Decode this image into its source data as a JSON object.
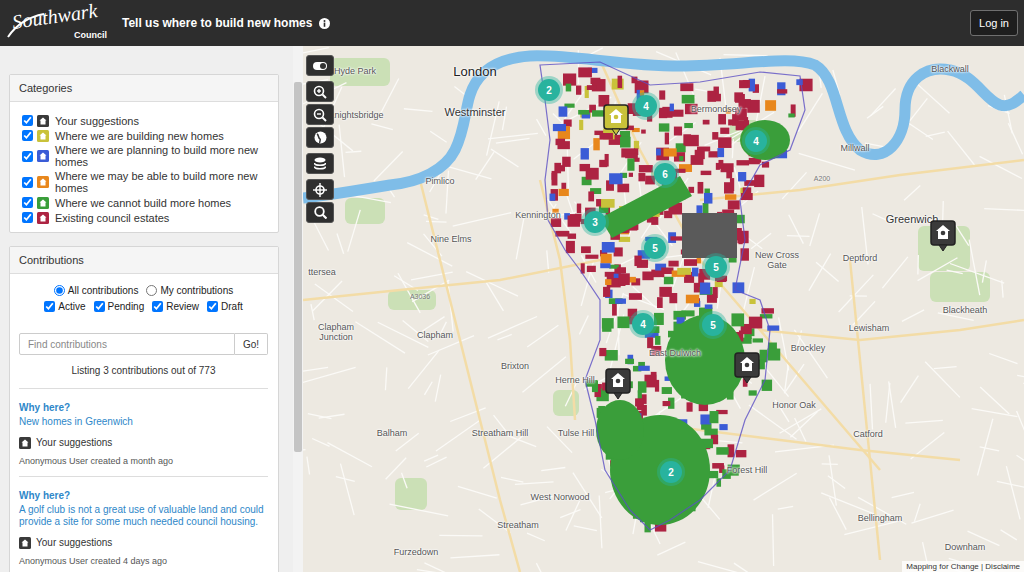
{
  "header": {
    "logo_title": "Southwark",
    "logo_subtitle": "Council",
    "title": "Tell us where to build new homes",
    "login_button": "Log in"
  },
  "categories": {
    "title": "Categories",
    "items": [
      {
        "label": "Your suggestions",
        "checked": true,
        "color": "#3a3a3a"
      },
      {
        "label": "Where we are building new homes",
        "checked": true,
        "color": "#c9c23a"
      },
      {
        "label": "Where we are planning to build more new homes",
        "checked": true,
        "color": "#3b5cd6"
      },
      {
        "label": "Where we may be able to build more new homes",
        "checked": true,
        "color": "#e8871c"
      },
      {
        "label": "Where we cannot build more homes",
        "checked": true,
        "color": "#3a9e3a"
      },
      {
        "label": "Existing council estates",
        "checked": true,
        "color": "#ad2342"
      }
    ]
  },
  "contributions": {
    "title": "Contributions",
    "scope": [
      {
        "label": "All contributions",
        "selected": true
      },
      {
        "label": "My contributions",
        "selected": false
      }
    ],
    "filters": [
      {
        "label": "Active",
        "checked": true
      },
      {
        "label": "Pending",
        "checked": true
      },
      {
        "label": "Review",
        "checked": true
      },
      {
        "label": "Draft",
        "checked": true
      }
    ],
    "search": {
      "placeholder": "Find contributions",
      "button": "Go!"
    },
    "summary": "Listing 3 contributions out of 773",
    "items": [
      {
        "heading": "Why here?",
        "title": "New homes in Greenwich",
        "category": "Your suggestions",
        "meta": "Anonymous User created a month ago"
      },
      {
        "heading": "Why here?",
        "title": "A golf club is not a great use of valuable land and could provide a site for some much needed council housing.",
        "category": "Your suggestions",
        "meta": "Anonymous User created 4 days ago"
      }
    ]
  },
  "map": {
    "place_labels": [
      {
        "text": "London",
        "kind": "city"
      },
      {
        "text": "Westminster",
        "kind": "town"
      },
      {
        "text": "Bermondsey",
        "kind": "district"
      },
      {
        "text": "Blackwall",
        "kind": "district"
      },
      {
        "text": "Knightsbridge",
        "kind": "district"
      },
      {
        "text": "Hyde Park",
        "kind": "district"
      },
      {
        "text": "Pimlico",
        "kind": "district"
      },
      {
        "text": "Kennington",
        "kind": "district"
      },
      {
        "text": "Nine Elms",
        "kind": "district"
      },
      {
        "text": "Millwall",
        "kind": "district"
      },
      {
        "text": "Greenwich",
        "kind": "town"
      },
      {
        "text": "Deptford",
        "kind": "district"
      },
      {
        "text": "New Cross Gate",
        "kind": "district"
      },
      {
        "text": "Blackheath",
        "kind": "district"
      },
      {
        "text": "Lewisham",
        "kind": "district"
      },
      {
        "text": "Brockley",
        "kind": "district"
      },
      {
        "text": "Clapham Junction",
        "kind": "district"
      },
      {
        "text": "Clapham",
        "kind": "district"
      },
      {
        "text": "Brixton",
        "kind": "district"
      },
      {
        "text": "Herne Hill",
        "kind": "district"
      },
      {
        "text": "East Dulwich",
        "kind": "district"
      },
      {
        "text": "Honor Oak",
        "kind": "district"
      },
      {
        "text": "Balham",
        "kind": "district"
      },
      {
        "text": "Streatham Hill",
        "kind": "district"
      },
      {
        "text": "Tulse Hill",
        "kind": "district"
      },
      {
        "text": "Catford",
        "kind": "district"
      },
      {
        "text": "Forest Hill",
        "kind": "district"
      },
      {
        "text": "West Norwood",
        "kind": "district"
      },
      {
        "text": "Streatham",
        "kind": "district"
      },
      {
        "text": "Bellingham",
        "kind": "district"
      },
      {
        "text": "Furzedown",
        "kind": "district"
      },
      {
        "text": "Downham",
        "kind": "district"
      },
      {
        "text": "ttersea",
        "kind": "district"
      }
    ],
    "road_labels": [
      "A3036",
      "A200"
    ],
    "clusters": [
      "2",
      "4",
      "4",
      "6",
      "3",
      "5",
      "5",
      "4",
      "5",
      "2"
    ],
    "markers": [
      {
        "category": "Your suggestions"
      },
      {
        "category": "Your suggestions"
      },
      {
        "category": "Your suggestions"
      },
      {
        "category": "Where we are building new homes"
      }
    ],
    "attribution": "Mapping for Change | Disclaime"
  }
}
